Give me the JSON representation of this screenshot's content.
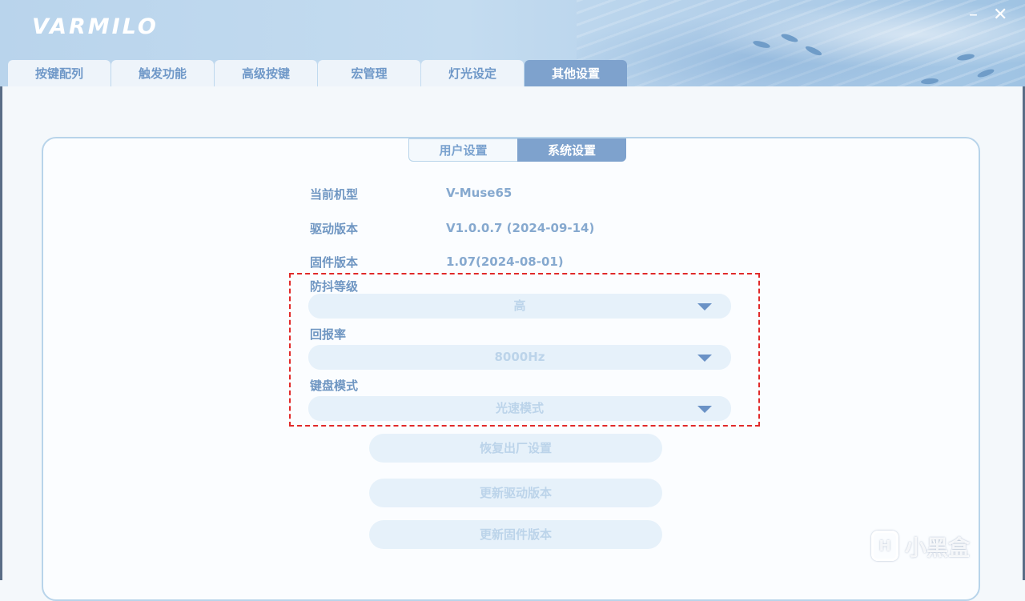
{
  "header": {
    "logo": "VARMILO",
    "minimize_icon": "minimize-icon",
    "close_icon": "close-icon"
  },
  "main_tabs": [
    {
      "label": "按键配列",
      "active": false
    },
    {
      "label": "触发功能",
      "active": false
    },
    {
      "label": "高级按键",
      "active": false
    },
    {
      "label": "宏管理",
      "active": false
    },
    {
      "label": "灯光设定",
      "active": false
    },
    {
      "label": "其他设置",
      "active": true
    }
  ],
  "sub_tabs": [
    {
      "label": "用户设置",
      "active": false
    },
    {
      "label": "系统设置",
      "active": true
    }
  ],
  "info": {
    "model_label": "当前机型",
    "model_value": "V-Muse65",
    "driver_label": "驱动版本",
    "driver_value": "V1.0.0.7 (2024-09-14)",
    "firmware_label": "固件版本",
    "firmware_value": "1.07(2024-08-01)"
  },
  "settings": {
    "debounce_label": "防抖等级",
    "debounce_value": "高",
    "polling_label": "回报率",
    "polling_value": "8000Hz",
    "mode_label": "键盘模式",
    "mode_value": "光速模式"
  },
  "buttons": {
    "reset": "恢复出厂设置",
    "update_driver": "更新驱动版本",
    "update_firmware": "更新固件版本"
  },
  "watermark": {
    "text": "小黑盒",
    "icon_glyph": "H"
  },
  "colors": {
    "accent": "#7ea2cd",
    "highlight_box": "#e12a2a"
  }
}
